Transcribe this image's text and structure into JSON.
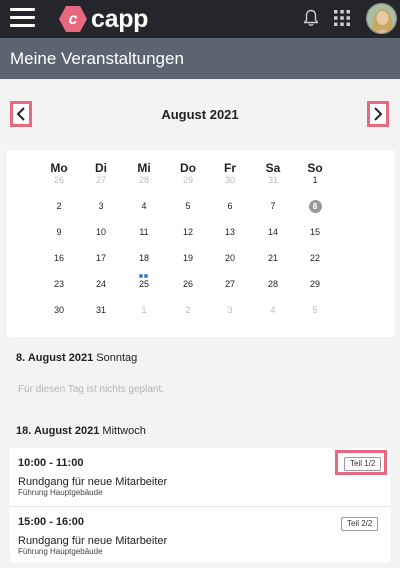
{
  "header": {
    "logo_text": "capp",
    "logo_letter": "c",
    "brand_color": "#e8697f",
    "icons": [
      "hamburger-menu-icon",
      "bell-icon",
      "apps-grid-icon",
      "user-avatar"
    ]
  },
  "page": {
    "title": "Meine Veranstaltungen"
  },
  "calendar": {
    "month_label": "August 2021",
    "weekdays": [
      "Mo",
      "Di",
      "Mi",
      "Do",
      "Fr",
      "Sa",
      "So"
    ],
    "weeks": [
      [
        {
          "d": "26",
          "muted": true
        },
        {
          "d": "27",
          "muted": true
        },
        {
          "d": "28",
          "muted": true
        },
        {
          "d": "29",
          "muted": true
        },
        {
          "d": "30",
          "muted": true
        },
        {
          "d": "31",
          "muted": true
        },
        {
          "d": "1"
        }
      ],
      [
        {
          "d": "2"
        },
        {
          "d": "3"
        },
        {
          "d": "4"
        },
        {
          "d": "5"
        },
        {
          "d": "6"
        },
        {
          "d": "7"
        },
        {
          "d": "8",
          "today": true
        }
      ],
      [
        {
          "d": "9"
        },
        {
          "d": "10"
        },
        {
          "d": "11"
        },
        {
          "d": "12"
        },
        {
          "d": "13"
        },
        {
          "d": "14"
        },
        {
          "d": "15"
        }
      ],
      [
        {
          "d": "16"
        },
        {
          "d": "17"
        },
        {
          "d": "18",
          "events": 2
        },
        {
          "d": "19"
        },
        {
          "d": "20"
        },
        {
          "d": "21"
        },
        {
          "d": "22"
        }
      ],
      [
        {
          "d": "23"
        },
        {
          "d": "24"
        },
        {
          "d": "25"
        },
        {
          "d": "26"
        },
        {
          "d": "27"
        },
        {
          "d": "28"
        },
        {
          "d": "29"
        }
      ],
      [
        {
          "d": "30"
        },
        {
          "d": "31"
        },
        {
          "d": "1",
          "muted": true
        },
        {
          "d": "2",
          "muted": true
        },
        {
          "d": "3",
          "muted": true
        },
        {
          "d": "4",
          "muted": true
        },
        {
          "d": "5",
          "muted": true
        }
      ]
    ],
    "event_dot_color": "#3f7ee0"
  },
  "days": [
    {
      "date": "8. August 2021",
      "weekday": "Sonntag",
      "empty_text": "Für diesen Tag ist nichts geplant."
    },
    {
      "date": "18. August 2021",
      "weekday": "Mittwoch",
      "events": [
        {
          "time": "10:00 - 11:00",
          "title": "Rundgang für neue Mitarbeiter",
          "location": "Führung Hauptgebäude",
          "part": "Teil 1/2"
        },
        {
          "time": "15:00 - 16:00",
          "title": "Rundgang für neue Mitarbeiter",
          "location": "Führung Hauptgebäude",
          "part": "Teil 2/2"
        }
      ]
    }
  ]
}
